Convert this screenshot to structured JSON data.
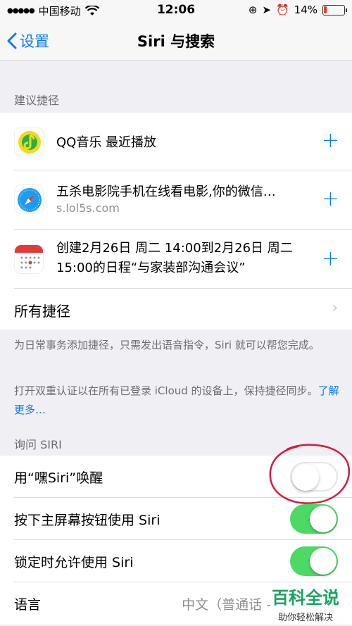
{
  "status_bar": {
    "carrier": "中国移动",
    "time": "12:06",
    "battery": "14%",
    "battery_level": 0.14
  },
  "nav": {
    "back_label": "设置",
    "title": "Siri 与搜索"
  },
  "suggested_shortcuts": {
    "header": "建议捷径",
    "items": [
      {
        "title": "QQ音乐 最近播放",
        "subtitle": "",
        "icon": "qq-music-icon"
      },
      {
        "title": "五杀电影院手机在线看电影,你的微信…",
        "subtitle": "s.lol5s.com",
        "icon": "safari-icon"
      },
      {
        "title": "创建2月26日 周二 14:00到2月26日 周二 15:00的日程“与家装部沟通会议”",
        "subtitle": "",
        "icon": "calendar-icon"
      }
    ],
    "all_shortcuts": "所有捷径",
    "footer1": "为日常事务添加捷径，只需发出语音指令，Siri 就可以帮您完成。",
    "footer2": "打开双重认证以在所有已登录 iCloud 的设备上，保持捷径同步。",
    "footer2_link": "了解更多…"
  },
  "ask_siri": {
    "header": "询问 SIRI",
    "rows": [
      {
        "label": "用“嘿Siri”唤醒",
        "on": false
      },
      {
        "label": "按下主屏幕按钮使用 Siri",
        "on": true
      },
      {
        "label": "锁定时允许使用 Siri",
        "on": true
      }
    ],
    "language_label": "语言",
    "language_value": "中文（普通话 -"
  },
  "watermark": {
    "line1": "百科全说",
    "line2": "助你轻松解决"
  },
  "colors": {
    "accent": "#0a7aff",
    "toggle_on": "#4cd964",
    "annotation": "#d81b3c"
  }
}
